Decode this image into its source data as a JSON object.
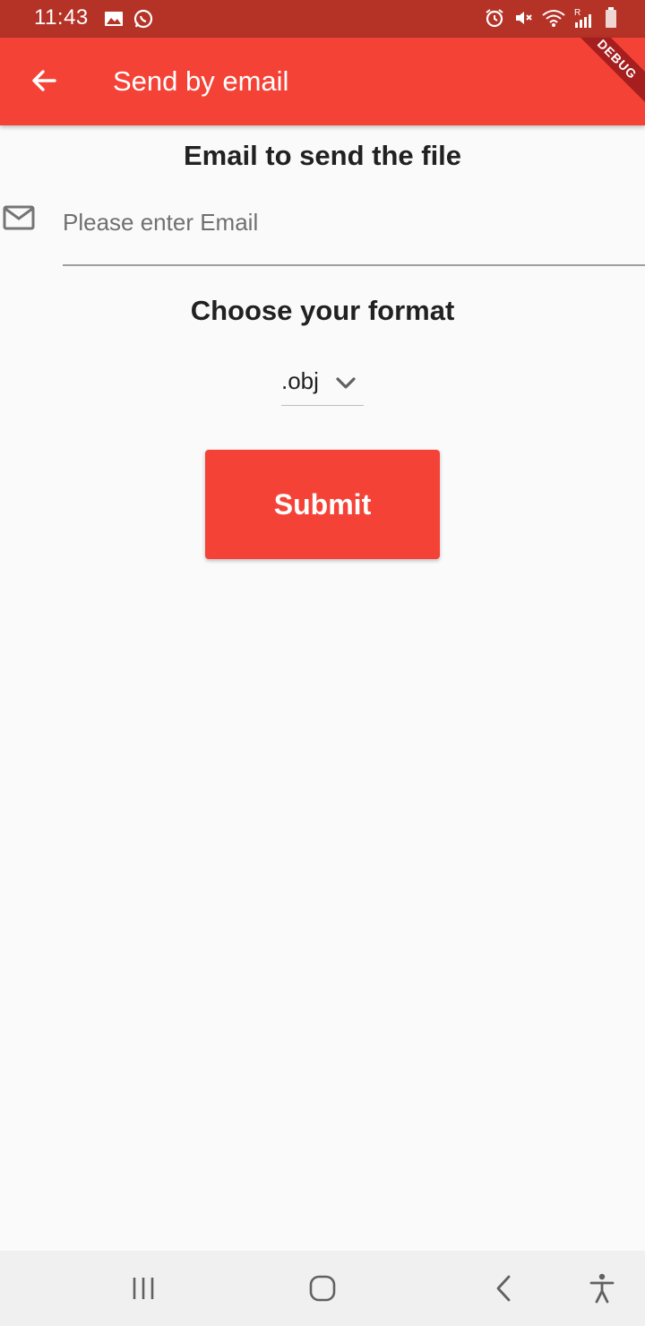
{
  "status_bar": {
    "time": "11:43",
    "icons_left": [
      "gallery-icon",
      "whatsapp-icon"
    ],
    "icons_right": [
      "alarm-icon",
      "mute-icon",
      "wifi-icon",
      "signal-icon",
      "battery-icon"
    ],
    "roaming_indicator": "R"
  },
  "app_bar": {
    "title": "Send by email",
    "back_icon": "arrow-back-icon",
    "color": "#f44336"
  },
  "debug_banner": "DEBUG",
  "email_section": {
    "title": "Email to send the file",
    "placeholder": "Please enter Email",
    "value": "",
    "icon": "mail-icon"
  },
  "format_section": {
    "title": "Choose your format",
    "selected": ".obj"
  },
  "submit": {
    "label": "Submit"
  },
  "nav_bar": {
    "buttons": [
      "recent-apps-icon",
      "home-icon",
      "back-icon",
      "accessibility-icon"
    ]
  }
}
